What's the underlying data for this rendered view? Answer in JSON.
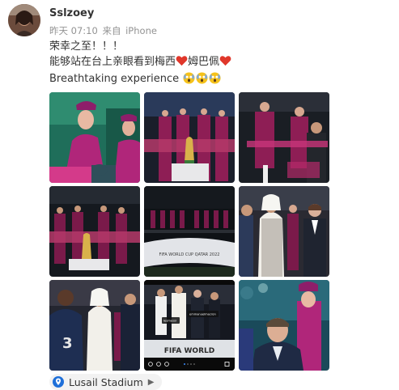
{
  "post": {
    "username": "Sslzoey",
    "timestamp": "昨天 07:10",
    "source_prefix": "来自",
    "source": "iPhone",
    "line1": "荣幸之至！！！",
    "line2_a": "能够站在台上亲眼看到梅西",
    "line2_b": "姆巴佩",
    "line3": "Breathtaking experience",
    "emoji_count": 3,
    "heart_color": "#e0372b"
  },
  "photos": {
    "count": 9,
    "overlay_texts": {
      "cup_banner": "FIFA WORLD CUP QATAR 2022",
      "bottom_banner": "FIFA WORLD",
      "tag1": "leomessi",
      "tag2": "emmanuelmacron",
      "jersey_number": "3"
    }
  },
  "location": {
    "icon": "location-pin-icon",
    "label": "Lusail Stadium",
    "accent_color": "#1e6fd9"
  }
}
